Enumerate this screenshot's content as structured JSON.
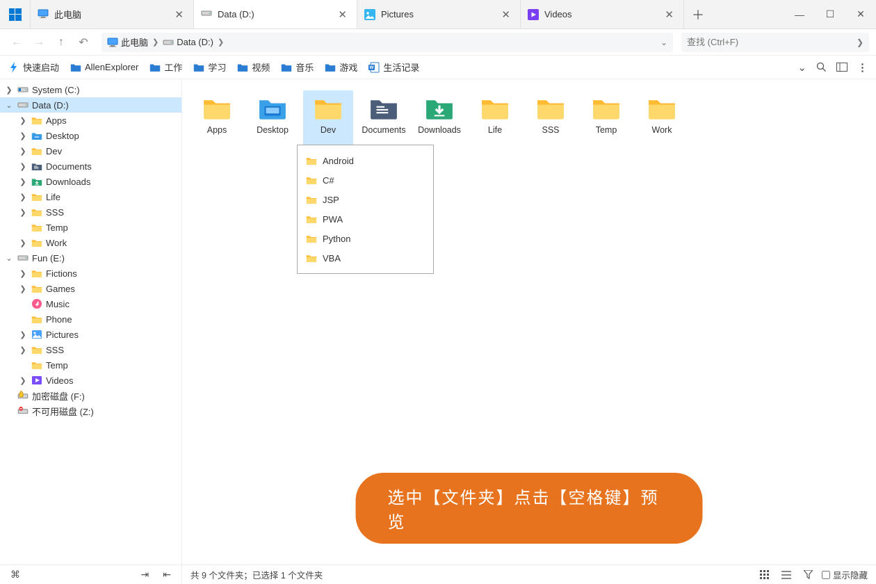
{
  "tabs": [
    {
      "label": "此电脑",
      "icon": "monitor"
    },
    {
      "label": "Data (D:)",
      "icon": "drive",
      "active": true
    },
    {
      "label": "Pictures",
      "icon": "image-app"
    },
    {
      "label": "Videos",
      "icon": "video-app"
    }
  ],
  "breadcrumb": [
    {
      "label": "此电脑",
      "icon": "monitor"
    },
    {
      "label": "Data (D:)",
      "icon": "drive"
    }
  ],
  "search": {
    "placeholder": "查找 (Ctrl+F)"
  },
  "bookmarks": {
    "quick": "快速启动",
    "items": [
      {
        "label": "AllenExplorer",
        "color": "#2b7cd3"
      },
      {
        "label": "工作",
        "color": "#2b7cd3"
      },
      {
        "label": "学习",
        "color": "#2b7cd3"
      },
      {
        "label": "视频",
        "color": "#2b7cd3"
      },
      {
        "label": "音乐",
        "color": "#2b7cd3"
      },
      {
        "label": "游戏",
        "color": "#2b7cd3"
      },
      {
        "label": "生活记录",
        "color": "#2b7cd3",
        "icon": "word"
      }
    ]
  },
  "tree": [
    {
      "level": 0,
      "expand": ">",
      "label": "System (C:)",
      "icon": "drive-sys"
    },
    {
      "level": 0,
      "expand": "v",
      "label": "Data (D:)",
      "icon": "drive",
      "selected": true
    },
    {
      "level": 1,
      "expand": ">",
      "label": "Apps",
      "icon": "folder"
    },
    {
      "level": 1,
      "expand": ">",
      "label": "Desktop",
      "icon": "desktop"
    },
    {
      "level": 1,
      "expand": ">",
      "label": "Dev",
      "icon": "folder"
    },
    {
      "level": 1,
      "expand": ">",
      "label": "Documents",
      "icon": "documents"
    },
    {
      "level": 1,
      "expand": ">",
      "label": "Downloads",
      "icon": "downloads"
    },
    {
      "level": 1,
      "expand": ">",
      "label": "Life",
      "icon": "folder"
    },
    {
      "level": 1,
      "expand": ">",
      "label": "SSS",
      "icon": "folder"
    },
    {
      "level": 1,
      "expand": "",
      "label": "Temp",
      "icon": "folder"
    },
    {
      "level": 1,
      "expand": ">",
      "label": "Work",
      "icon": "folder"
    },
    {
      "level": 0,
      "expand": "v",
      "label": "Fun (E:)",
      "icon": "drive"
    },
    {
      "level": 1,
      "expand": ">",
      "label": "Fictions",
      "icon": "folder"
    },
    {
      "level": 1,
      "expand": ">",
      "label": "Games",
      "icon": "folder"
    },
    {
      "level": 1,
      "expand": "",
      "label": "Music",
      "icon": "music"
    },
    {
      "level": 1,
      "expand": "",
      "label": "Phone",
      "icon": "folder"
    },
    {
      "level": 1,
      "expand": ">",
      "label": "Pictures",
      "icon": "pictures"
    },
    {
      "level": 1,
      "expand": ">",
      "label": "SSS",
      "icon": "folder"
    },
    {
      "level": 1,
      "expand": "",
      "label": "Temp",
      "icon": "folder"
    },
    {
      "level": 1,
      "expand": ">",
      "label": "Videos",
      "icon": "videos"
    },
    {
      "level": 0,
      "expand": "",
      "label": "加密磁盘 (F:)",
      "icon": "drive-lock"
    },
    {
      "level": 0,
      "expand": "",
      "label": "不可用磁盘 (Z:)",
      "icon": "drive-na"
    }
  ],
  "folders": [
    {
      "label": "Apps",
      "icon": "folder"
    },
    {
      "label": "Desktop",
      "icon": "desktop"
    },
    {
      "label": "Dev",
      "icon": "folder",
      "selected": true
    },
    {
      "label": "Documents",
      "icon": "documents"
    },
    {
      "label": "Downloads",
      "icon": "downloads"
    },
    {
      "label": "Life",
      "icon": "folder"
    },
    {
      "label": "SSS",
      "icon": "folder"
    },
    {
      "label": "Temp",
      "icon": "folder"
    },
    {
      "label": "Work",
      "icon": "folder"
    }
  ],
  "preview": [
    {
      "label": "Android"
    },
    {
      "label": "C#"
    },
    {
      "label": "JSP"
    },
    {
      "label": "PWA"
    },
    {
      "label": "Python"
    },
    {
      "label": "VBA"
    }
  ],
  "hint": "选中【文件夹】点击【空格键】预览",
  "status": {
    "left": "共 9 个文件夹；已选择 1 个文件夹",
    "showHidden": "显示隐藏"
  }
}
